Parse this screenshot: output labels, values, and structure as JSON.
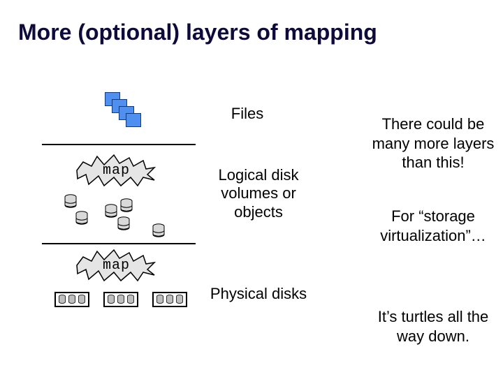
{
  "title": "More (optional) layers of mapping",
  "layers": {
    "files": "Files",
    "logical": "Logical disk volumes or objects",
    "physical": "Physical disks"
  },
  "map_label": "map",
  "notes": {
    "n1": "There could be many more layers than this!",
    "n2": "For “storage virtualization”…",
    "n3": "It’s turtles all the way down."
  },
  "icons": {
    "file": "file-square-icon",
    "db": "database-icon",
    "rack": "disk-rack-icon",
    "burst": "starburst-icon"
  }
}
